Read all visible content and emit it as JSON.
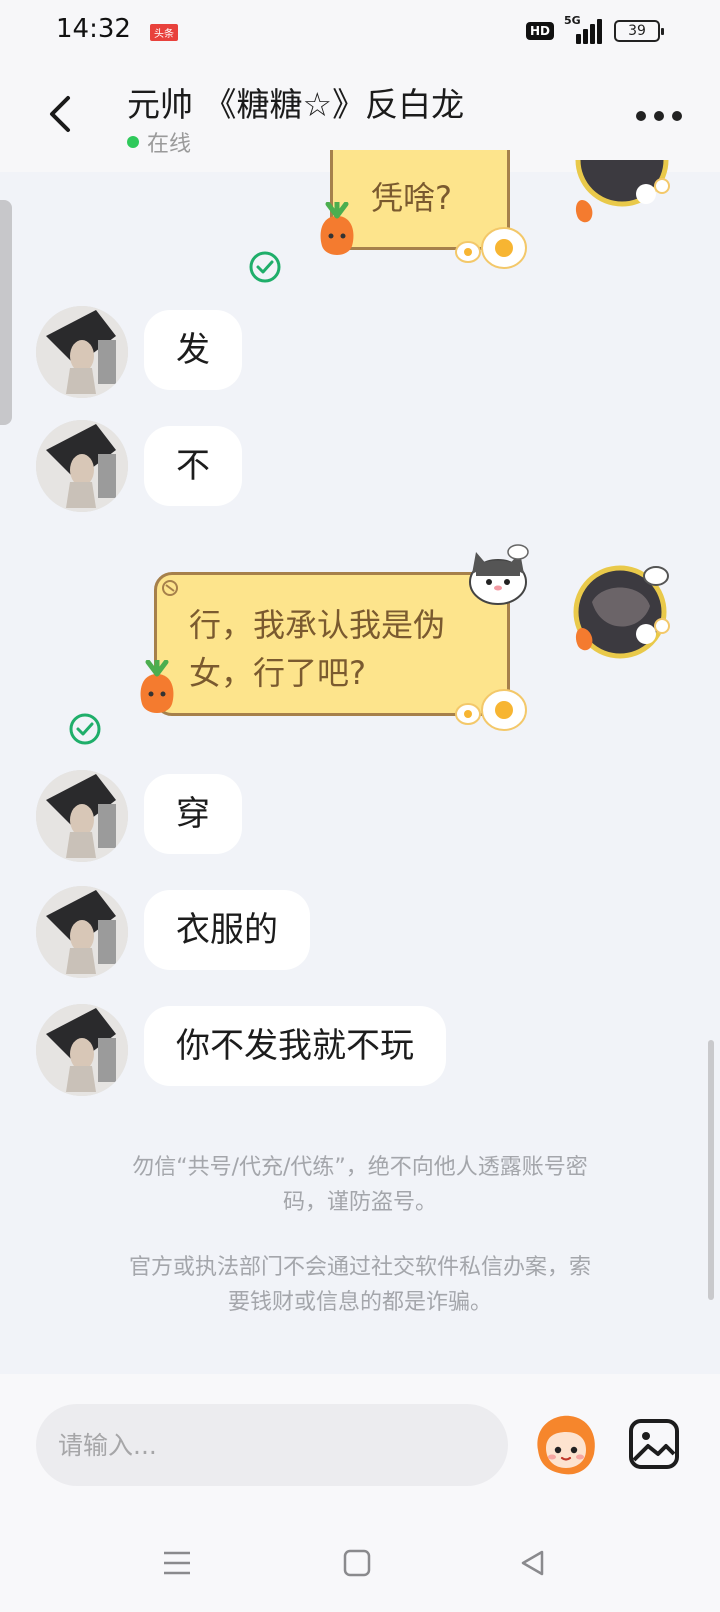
{
  "status_bar": {
    "time": "14:32",
    "app_badge": "头条",
    "hd_label": "HD",
    "network": "5G",
    "battery": "39"
  },
  "header": {
    "title": "元帅 《糖糖☆》反白龙",
    "status": "在线"
  },
  "messages": [
    {
      "from": "me",
      "text": "凭啥?",
      "read": true
    },
    {
      "from": "other",
      "text": "发"
    },
    {
      "from": "other",
      "text": "不"
    },
    {
      "from": "me",
      "text_line1": "行，我承认我是伪",
      "text_line2": "女，行了吧?",
      "read": true
    },
    {
      "from": "other",
      "text": "穿"
    },
    {
      "from": "other",
      "text": "衣服的"
    },
    {
      "from": "other",
      "text": "你不发我就不玩"
    }
  ],
  "notices": {
    "line1": "勿信“共号/代充/代练”，绝不向他人透露账号密",
    "line2": "码，谨防盗号。",
    "line3": "官方或执法部门不会通过社交软件私信办案，索",
    "line4": "要钱财或信息的都是诈骗。"
  },
  "input": {
    "placeholder": "请输入..."
  },
  "colors": {
    "bubble_out": "#fde48c",
    "bubble_out_border": "#a6804b",
    "online": "#2fc95b",
    "read_check": "#1fae6a"
  }
}
